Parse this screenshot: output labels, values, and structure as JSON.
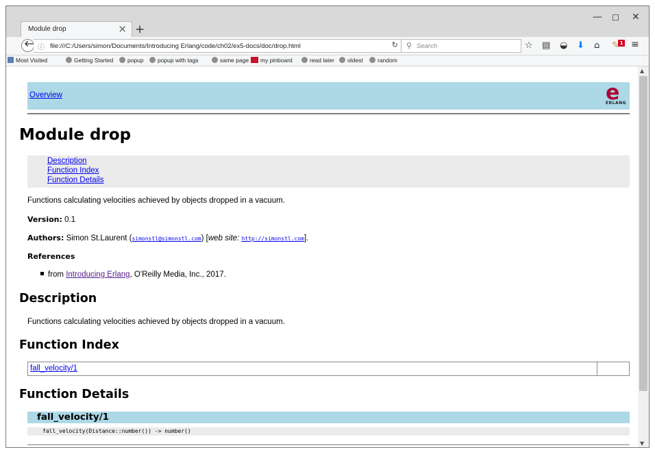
{
  "browser": {
    "tab_title": "Module drop",
    "tab_close": "×",
    "new_tab": "+",
    "window_controls": {
      "minimize": "—",
      "maximize": "☐",
      "close": "✕"
    },
    "url": "file:///C:/Users/simon/Documents/Introducing Erlang/code/ch02/ex5-docs/doc/drop.html",
    "search_placeholder": "Search",
    "notification_count": "1",
    "bookmarks": [
      {
        "label": "Most Visited"
      },
      {
        "label": "Getting Started"
      },
      {
        "label": "popup"
      },
      {
        "label": "popup with tags"
      },
      {
        "label": "same page"
      },
      {
        "label": "my pinboard"
      },
      {
        "label": "read later"
      },
      {
        "label": "oldest"
      },
      {
        "label": "random"
      }
    ]
  },
  "page": {
    "nav_link": "Overview",
    "logo_text": "ERLANG",
    "module_title": "Module drop",
    "toc": [
      "Description",
      "Function Index",
      "Function Details"
    ],
    "summary": "Functions calculating velocities achieved by objects dropped in a vacuum.",
    "version_label": "Version:",
    "version_value": "0.1",
    "authors_label": "Authors:",
    "author_name": "Simon St.Laurent (",
    "author_email": "simonstl@simonstl.com",
    "website_label_pre": ") [",
    "website_label": "web site:",
    "website_url": "http://simonstl.com",
    "website_close": "].",
    "references_label": "References",
    "reference_pre": "from ",
    "reference_link": "Introducing Erlang",
    "reference_post": ", O'Reilly Media, Inc., 2017.",
    "description_heading": "Description",
    "description_text": "Functions calculating velocities achieved by objects dropped in a vacuum.",
    "function_index_heading": "Function Index",
    "function_index_items": [
      "fall_velocity/1"
    ],
    "function_details_heading": "Function Details",
    "function_name": "fall_velocity/1",
    "function_signature": "fall_velocity(Distance::number()) -> number()"
  }
}
